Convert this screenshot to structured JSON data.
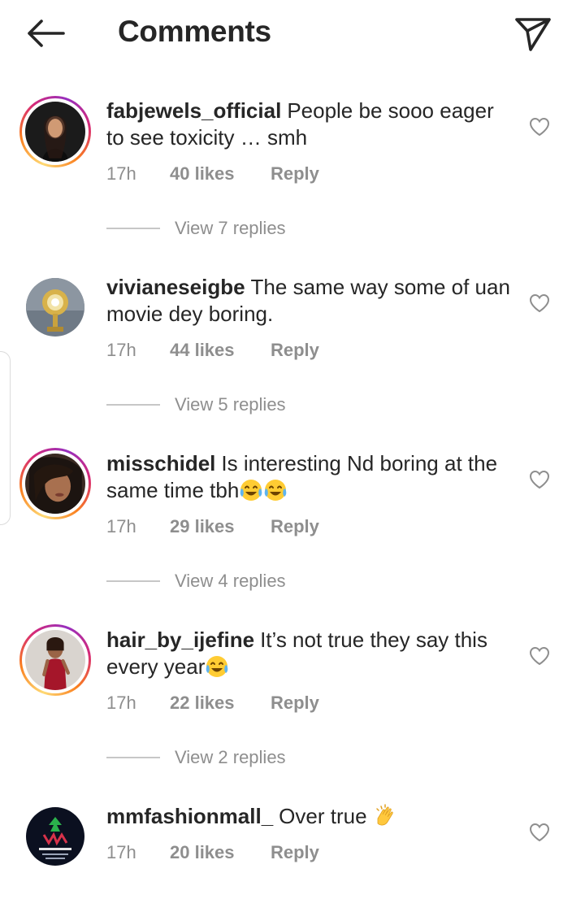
{
  "header": {
    "title": "Comments",
    "back_icon": "arrow-left-icon",
    "share_icon": "paper-plane-icon"
  },
  "colors": {
    "text": "#262626",
    "secondary": "#8e8e8e",
    "divider": "#c7c7c7",
    "story_ring": [
      "#feda75",
      "#fa7e1e",
      "#d62976",
      "#962fbf"
    ]
  },
  "comments": [
    {
      "username": "fabjewels_official",
      "text": "People be sooo eager to see toxicity … smh",
      "emoji": [],
      "time": "17h",
      "likes": "40 likes",
      "reply": "Reply",
      "view_replies": "View 7 replies",
      "story_ring": true
    },
    {
      "username": "vivianeseigbe",
      "text": "The same way some of uan movie dey boring.",
      "emoji": [],
      "time": "17h",
      "likes": "44 likes",
      "reply": "Reply",
      "view_replies": "View 5 replies",
      "story_ring": false
    },
    {
      "username": "misschidel",
      "text": "Is interesting Nd boring at the same time tbh",
      "emoji": [
        "face-with-tears-of-joy",
        "face-with-tears-of-joy"
      ],
      "time": "17h",
      "likes": "29 likes",
      "reply": "Reply",
      "view_replies": "View 4 replies",
      "story_ring": true
    },
    {
      "username": "hair_by_ijefine",
      "text": "It’s not true they say this every year",
      "emoji": [
        "face-with-tears-of-joy"
      ],
      "time": "17h",
      "likes": "22 likes",
      "reply": "Reply",
      "view_replies": "View 2 replies",
      "story_ring": true
    },
    {
      "username": "mmfashionmall_",
      "text": "Over true ",
      "emoji": [
        "clapping-hands"
      ],
      "time": "17h",
      "likes": "20 likes",
      "reply": "Reply",
      "story_ring": false,
      "avatar_logo_text": "MM FASHION MALL"
    }
  ]
}
